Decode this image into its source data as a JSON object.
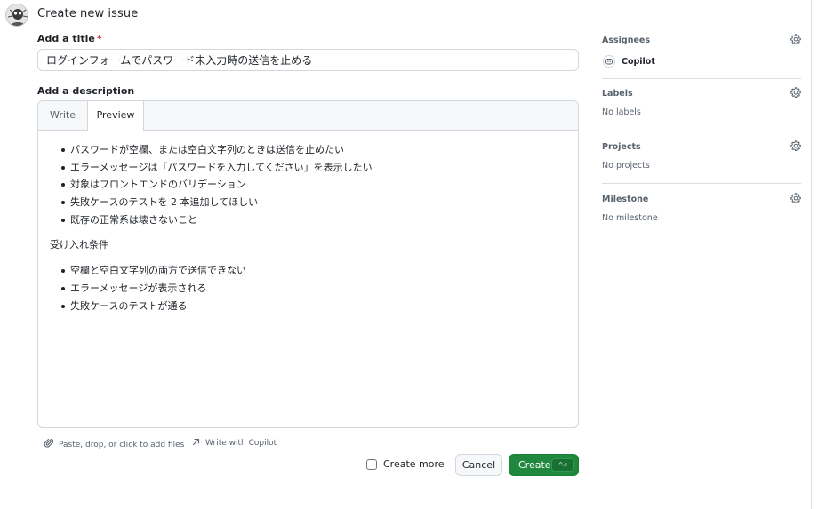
{
  "header": {
    "title": "Create new issue"
  },
  "form": {
    "title_label": "Add a title",
    "required_mark": "*",
    "title_value": "ログインフォームでパスワード未入力時の送信を止める",
    "description_label": "Add a description",
    "tabs": {
      "write": "Write",
      "preview": "Preview"
    },
    "active_tab": "Preview",
    "preview": {
      "list1": [
        "パスワードが空欄、または空白文字列のときは送信を止めたい",
        "エラーメッセージは「パスワードを入力してください」を表示したい",
        "対象はフロントエンドのバリデーション",
        "失敗ケースのテストを 2 本追加してほしい",
        "既存の正常系は壊さないこと"
      ],
      "heading": "受け入れ条件",
      "list2": [
        "空欄と空白文字列の両方で送信できない",
        "エラーメッセージが表示される",
        "失敗ケースのテストが通る"
      ]
    },
    "attach_hint": "Paste, drop, or click to add files",
    "copilot_hint": "Write with Copilot"
  },
  "actions": {
    "create_more_label": "Create more",
    "create_more_checked": false,
    "cancel_label": "Cancel",
    "create_label": "Create",
    "create_shortcut": "^⏎"
  },
  "sidebar": {
    "assignees": {
      "label": "Assignees",
      "value": "Copilot"
    },
    "labels": {
      "label": "Labels",
      "value": "No labels"
    },
    "projects": {
      "label": "Projects",
      "value": "No projects"
    },
    "milestone": {
      "label": "Milestone",
      "value": "No milestone"
    }
  },
  "colors": {
    "primary_button": "#1f883d",
    "required": "#d1242f",
    "border": "#d0d7de"
  },
  "icons": [
    "avatar",
    "paperclip-icon",
    "arrow-up-right-icon",
    "gear-icon",
    "copilot-icon"
  ]
}
